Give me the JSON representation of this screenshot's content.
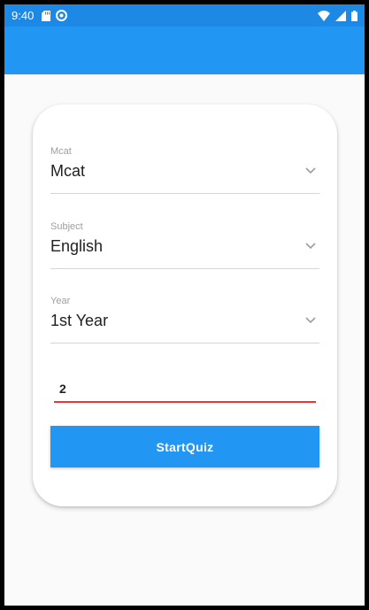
{
  "status_bar": {
    "time": "9:40",
    "icons_left": [
      "sd-card-icon",
      "sync-icon"
    ],
    "icons_right": [
      "wifi-icon",
      "signal-icon",
      "battery-icon"
    ]
  },
  "colors": {
    "app_bar": "#2196f3",
    "status_bar": "#1e88e5",
    "button": "#2196f3",
    "input_underline": "#e53935"
  },
  "form": {
    "fields": [
      {
        "label": "Mcat",
        "value": "Mcat"
      },
      {
        "label": "Subject",
        "value": "English"
      },
      {
        "label": "Year",
        "value": "1st Year"
      }
    ],
    "text_input": {
      "value": "2"
    },
    "start_button_label": "StartQuiz"
  }
}
